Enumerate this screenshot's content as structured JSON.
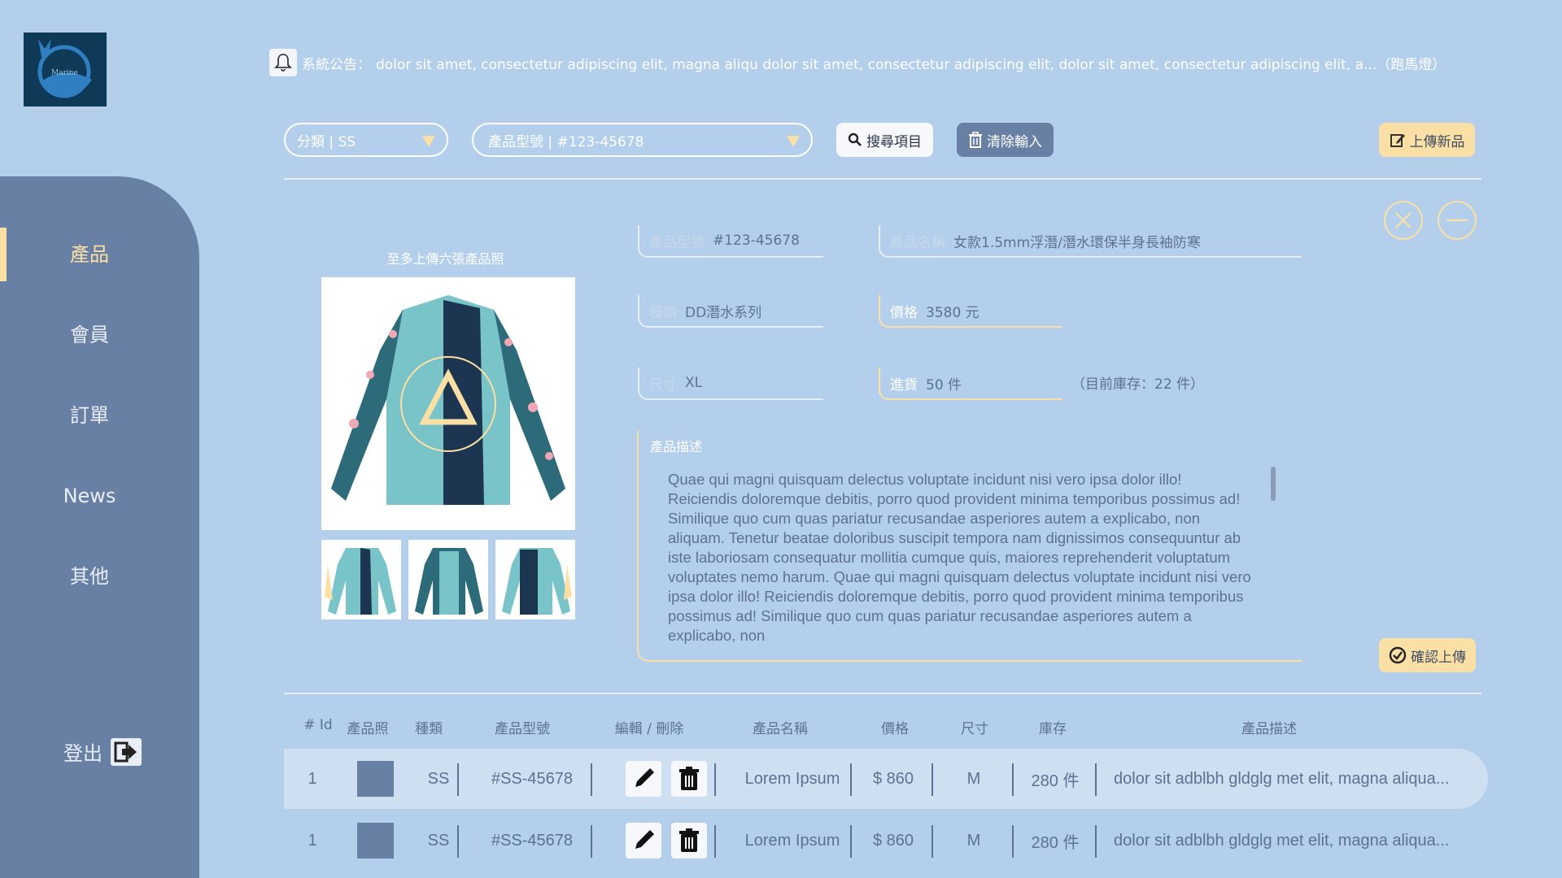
{
  "logo": {
    "text": "Marine"
  },
  "sidebar": {
    "items": [
      {
        "label": "產品",
        "active": true
      },
      {
        "label": "會員",
        "active": false
      },
      {
        "label": "訂單",
        "active": false
      },
      {
        "label": "News",
        "active": false
      },
      {
        "label": "其他",
        "active": false
      }
    ],
    "logout_label": "登出"
  },
  "announcement": {
    "prefix": "系統公告：",
    "text": "dolor sit amet, consectetur adipiscing elit, magna aliqu dolor sit amet, consectetur adipiscing elit, dolor sit amet, consectetur adipiscing elit, a...（跑馬燈）"
  },
  "filters": {
    "category": "分類 | SS",
    "model": "產品型號 | #123-45678",
    "search_label": "搜尋項目",
    "clear_label": "清除輸入",
    "upload_label": "上傳新品"
  },
  "form": {
    "photo_hint": "至多上傳六張產品照",
    "model_label": "產品型號",
    "model_value": "#123-45678",
    "name_label": "產品名稱",
    "name_value": "女款1.5mm浮潛/潛水環保半身長袖防寒",
    "type_label": "種類",
    "type_value": "DD潛水系列",
    "price_label": "價格",
    "price_value": "3580 元",
    "size_label": "尺寸",
    "size_value": "XL",
    "restock_label": "進貨",
    "restock_value": "50 件",
    "stock_note": "（目前庫存：22 件）",
    "desc_label": "產品描述",
    "desc_text": "Quae qui magni quisquam delectus voluptate incidunt nisi vero ipsa dolor illo! Reiciendis doloremque debitis, porro quod provident minima temporibus possimus ad! Similique quo cum quas pariatur recusandae asperiores autem a explicabo, non aliquam. Tenetur beatae doloribus suscipit tempora nam dignissimos consequuntur ab iste laboriosam consequatur mollitia cumque quis, maiores reprehenderit voluptatum voluptates nemo harum. Quae qui magni quisquam delectus voluptate incidunt nisi vero ipsa dolor illo! Reiciendis doloremque debitis, porro quod provident minima temporibus possimus ad! Similique quo cum quas pariatur recusandae asperiores autem a explicabo, non",
    "confirm_label": "確認上傳"
  },
  "table": {
    "headers": [
      "# Id",
      "產品照",
      "種類",
      "產品型號",
      "編輯 / 刪除",
      "產品名稱",
      "價格",
      "尺寸",
      "庫存",
      "產品描述"
    ],
    "rows": [
      {
        "id": "1",
        "type": "SS",
        "model": "#SS-45678",
        "name": "Lorem Ipsum",
        "price": "$ 860",
        "size": "M",
        "stock": "280 件",
        "desc": "dolor sit adblbh gldglg met elit, magna aliqua..."
      },
      {
        "id": "1",
        "type": "SS",
        "model": "#SS-45678",
        "name": "Lorem Ipsum",
        "price": "$ 860",
        "size": "M",
        "stock": "280 件",
        "desc": "dolor sit adblbh gldglg met elit, magna aliqua..."
      }
    ]
  },
  "colors": {
    "background": "#b3cfeb",
    "sidebar": "#6880a3",
    "accent": "#fbe0a6",
    "text": "#5f7190"
  }
}
